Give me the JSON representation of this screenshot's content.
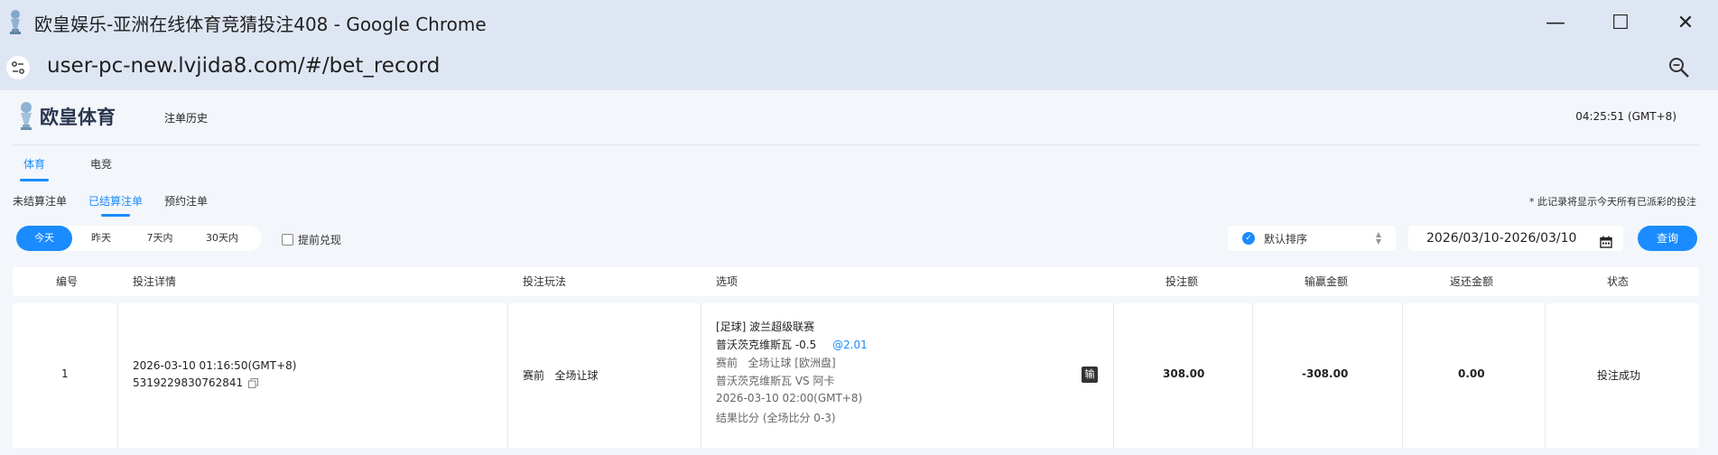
{
  "window": {
    "title": "欧皇娱乐-亚洲在线体育竞猜投注408 - Google Chrome",
    "minimize": "—",
    "maximize": "☐",
    "close": "✕"
  },
  "address": {
    "url": "user-pc-new.lvjida8.com/#/bet_record"
  },
  "header": {
    "logo_text": "欧皇体育",
    "page_title": "注单历史",
    "clock": "04:25:51 (GMT+8)"
  },
  "tabs": [
    {
      "label": "体育",
      "active": true
    },
    {
      "label": "电竞",
      "active": false
    }
  ],
  "subtabs": [
    {
      "label": "未结算注单",
      "active": false
    },
    {
      "label": "已结算注单",
      "active": true
    },
    {
      "label": "预约注单",
      "active": false
    }
  ],
  "notice": "* 此记录将显示今天所有已派彩的投注",
  "filters": {
    "ranges": [
      {
        "label": "今天",
        "active": true
      },
      {
        "label": "昨天",
        "active": false
      },
      {
        "label": "7天内",
        "active": false
      },
      {
        "label": "30天内",
        "active": false
      }
    ],
    "early_cashout_label": "提前兑现",
    "sort_label": "默认排序",
    "date_range": "2026/03/10-2026/03/10",
    "query_label": "查询"
  },
  "table": {
    "headers": {
      "id": "编号",
      "detail": "投注详情",
      "play": "投注玩法",
      "option": "选项",
      "stake": "投注额",
      "winloss": "输赢金额",
      "refund": "返还金额",
      "status": "状态"
    },
    "rows": [
      {
        "id": "1",
        "time": "2026-03-10 01:16:50(GMT+8)",
        "order_no": "5319229830762841",
        "play": "赛前   全场让球",
        "league": "[足球] 波兰超级联赛",
        "selection": "普沃茨克维斯瓦 -0.5",
        "odds": "@2.01",
        "market": "赛前   全场让球 [欧洲盘]",
        "match": "普沃茨克维斯瓦 VS 阿卡",
        "kickoff": "2026-03-10 02:00(GMT+8)",
        "score": "结果比分 (全场比分 0-3)",
        "result_badge": "输",
        "stake": "308.00",
        "winloss": "-308.00",
        "refund": "0.00",
        "status": "投注成功"
      }
    ]
  },
  "colors": {
    "accent": "#1a8cff",
    "chrome": "#dfe6f3",
    "page_bg": "#f3f6fa"
  }
}
